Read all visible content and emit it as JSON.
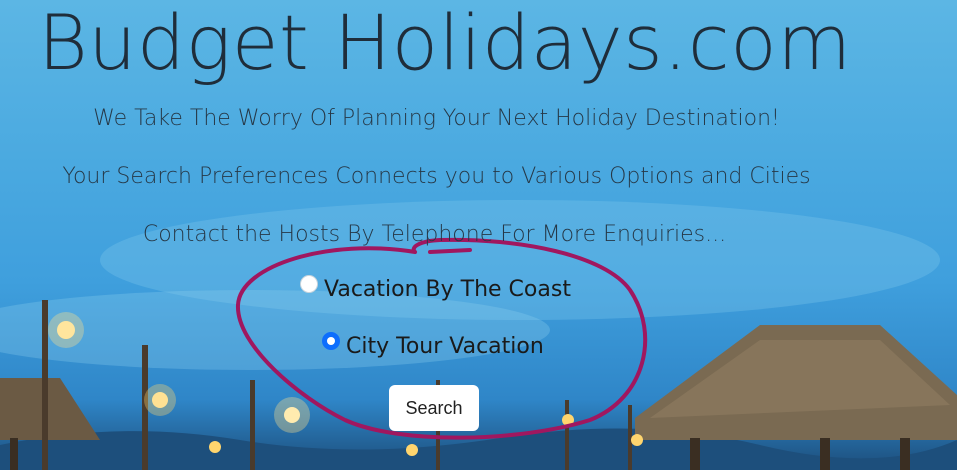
{
  "header": {
    "title": "Budget Holidays.com"
  },
  "taglines": [
    "We Take The Worry Of Planning Your Next Holiday Destination!",
    "Your Search Preferences Connects you to Various Options and Cities",
    "Contact the Hosts By Telephone For More Enquiries..."
  ],
  "options": [
    {
      "label": "Vacation By The Coast",
      "checked": false
    },
    {
      "label": "City Tour Vacation",
      "checked": true
    }
  ],
  "search": {
    "button_label": "Search"
  },
  "colors": {
    "accent": "#0d6efd",
    "annotation": "#a0175f"
  }
}
